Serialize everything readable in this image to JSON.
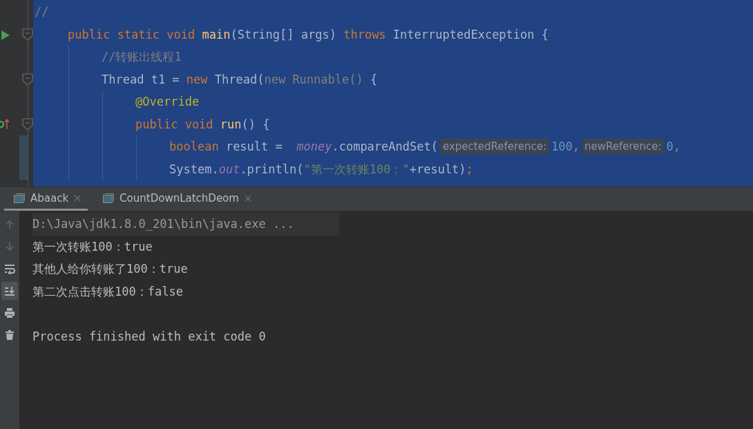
{
  "editor": {
    "lines": [
      {
        "tokens": [
          {
            "kind": "comment",
            "text": "//"
          }
        ],
        "runnable": false,
        "foldable": false,
        "implements": false,
        "changed": false,
        "children": [
          {
            "tokens": [
              {
                "kind": "keyword",
                "text": "public static void "
              },
              {
                "kind": "function",
                "text": "main"
              },
              {
                "kind": "plain",
                "text": "(String[] args) "
              },
              {
                "kind": "keyword",
                "text": "throws "
              },
              {
                "kind": "plain",
                "text": "InterruptedException {"
              }
            ],
            "runnable": true,
            "foldable": true,
            "implements": false,
            "changed": false,
            "children": [
              {
                "tokens": [
                  {
                    "kind": "comment",
                    "text": "//转账出线程1"
                  }
                ],
                "runnable": false,
                "foldable": false,
                "implements": false,
                "changed": false
              },
              {
                "tokens": [
                  {
                    "kind": "plain",
                    "text": "Thread t1 = "
                  },
                  {
                    "kind": "keyword",
                    "text": "new "
                  },
                  {
                    "kind": "plain",
                    "text": "Thread("
                  },
                  {
                    "kind": "dim",
                    "text": "new Runnable() "
                  },
                  {
                    "kind": "plain",
                    "text": "{"
                  }
                ],
                "runnable": false,
                "foldable": true,
                "implements": false,
                "changed": false,
                "children": [
                  {
                    "tokens": [
                      {
                        "kind": "annotation",
                        "text": "@Override"
                      }
                    ],
                    "runnable": false,
                    "foldable": false,
                    "implements": false,
                    "changed": false
                  },
                  {
                    "tokens": [
                      {
                        "kind": "keyword",
                        "text": "public void "
                      },
                      {
                        "kind": "function",
                        "text": "run"
                      },
                      {
                        "kind": "plain",
                        "text": "() {"
                      }
                    ],
                    "runnable": false,
                    "foldable": true,
                    "implements": true,
                    "changed": false,
                    "children": [
                      {
                        "tokens": [
                          {
                            "kind": "keyword",
                            "text": "boolean "
                          },
                          {
                            "kind": "plain",
                            "text": "result =  "
                          },
                          {
                            "kind": "field",
                            "text": "money"
                          },
                          {
                            "kind": "plain",
                            "text": ".compareAndSet("
                          },
                          {
                            "kind": "hint",
                            "text": "expectedReference:"
                          },
                          {
                            "kind": "number",
                            "text": "100"
                          },
                          {
                            "kind": "keyword",
                            "text": ","
                          },
                          {
                            "kind": "hint",
                            "text": "newReference:"
                          },
                          {
                            "kind": "number",
                            "text": "0"
                          },
                          {
                            "kind": "keyword",
                            "text": ","
                          }
                        ],
                        "runnable": false,
                        "foldable": false,
                        "implements": false,
                        "changed": true
                      },
                      {
                        "tokens": [
                          {
                            "kind": "plain",
                            "text": "System."
                          },
                          {
                            "kind": "field",
                            "text": "out"
                          },
                          {
                            "kind": "plain",
                            "text": ".println("
                          },
                          {
                            "kind": "string",
                            "text": "\"第一次转账100："
                          },
                          {
                            "kind": "string",
                            "text": "\""
                          },
                          {
                            "kind": "plain",
                            "text": "+result)"
                          },
                          {
                            "kind": "keyword",
                            "text": ";"
                          }
                        ],
                        "runnable": false,
                        "foldable": false,
                        "implements": false,
                        "changed": true
                      }
                    ]
                  }
                ]
              }
            ]
          }
        ]
      }
    ]
  },
  "run_panel": {
    "tabs": [
      {
        "label": "Abaack",
        "selected": true
      },
      {
        "label": "CountDownLatchDeom",
        "selected": false
      }
    ],
    "toolbar": [
      {
        "kind": "up",
        "disabled": true,
        "on": false
      },
      {
        "kind": "down",
        "disabled": true,
        "on": false
      },
      {
        "kind": "wrap",
        "disabled": false,
        "on": false
      },
      {
        "kind": "scroll-end",
        "disabled": false,
        "on": true
      },
      {
        "kind": "print",
        "disabled": false,
        "on": false
      },
      {
        "kind": "trash",
        "disabled": false,
        "on": false
      }
    ],
    "console": [
      {
        "kind": "command",
        "text": "D:\\Java\\jdk1.8.0_201\\bin\\java.exe ..."
      },
      {
        "kind": "output",
        "text": "第一次转账100：true"
      },
      {
        "kind": "output",
        "text": "其他人给你转账了100：true"
      },
      {
        "kind": "output",
        "text": "第二次点击转账100：false"
      },
      {
        "kind": "exit",
        "text": "Process finished with exit code 0"
      }
    ]
  }
}
